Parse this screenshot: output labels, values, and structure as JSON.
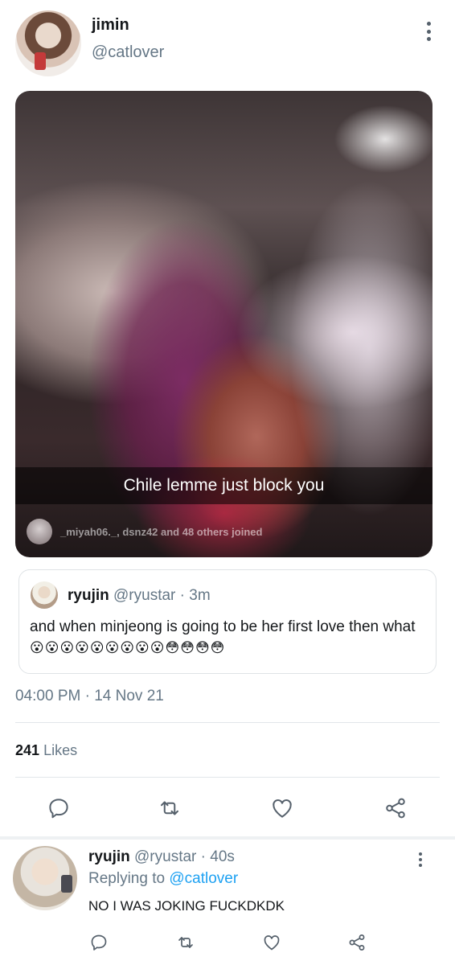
{
  "tweet": {
    "author": {
      "name": "jimin",
      "handle": "@catlover"
    },
    "media": {
      "caption": "Chile lemme just block you",
      "joined_text": "_miyah06._, dsnz42 and 48 others joined"
    },
    "quoted": {
      "name": "ryujin",
      "handle": "@ryustar",
      "dot": "·",
      "time": "3m",
      "text": "and when minjeong is going to be her first love then what",
      "emojis": "😮😮😮😮😮😮😮😮😮😳😳😳😳"
    },
    "timestamp": "04:00 PM · 14 Nov 21",
    "likes": {
      "count": "241",
      "label": "Likes"
    },
    "actions": {
      "reply_icon": "reply-icon",
      "retweet_icon": "retweet-icon",
      "like_icon": "heart-icon",
      "share_icon": "share-icon"
    }
  },
  "reply": {
    "name": "ryujin",
    "handle": "@ryustar",
    "dot": "·",
    "time": "40s",
    "replying_prefix": "Replying to",
    "replying_to": "@catlover",
    "text": "NO I WAS JOKING FUCKDKDK"
  },
  "colors": {
    "text": "#14171a",
    "muted": "#657786",
    "link": "#1da1f2",
    "icon": "#55606b",
    "border": "#e1e6ea"
  }
}
